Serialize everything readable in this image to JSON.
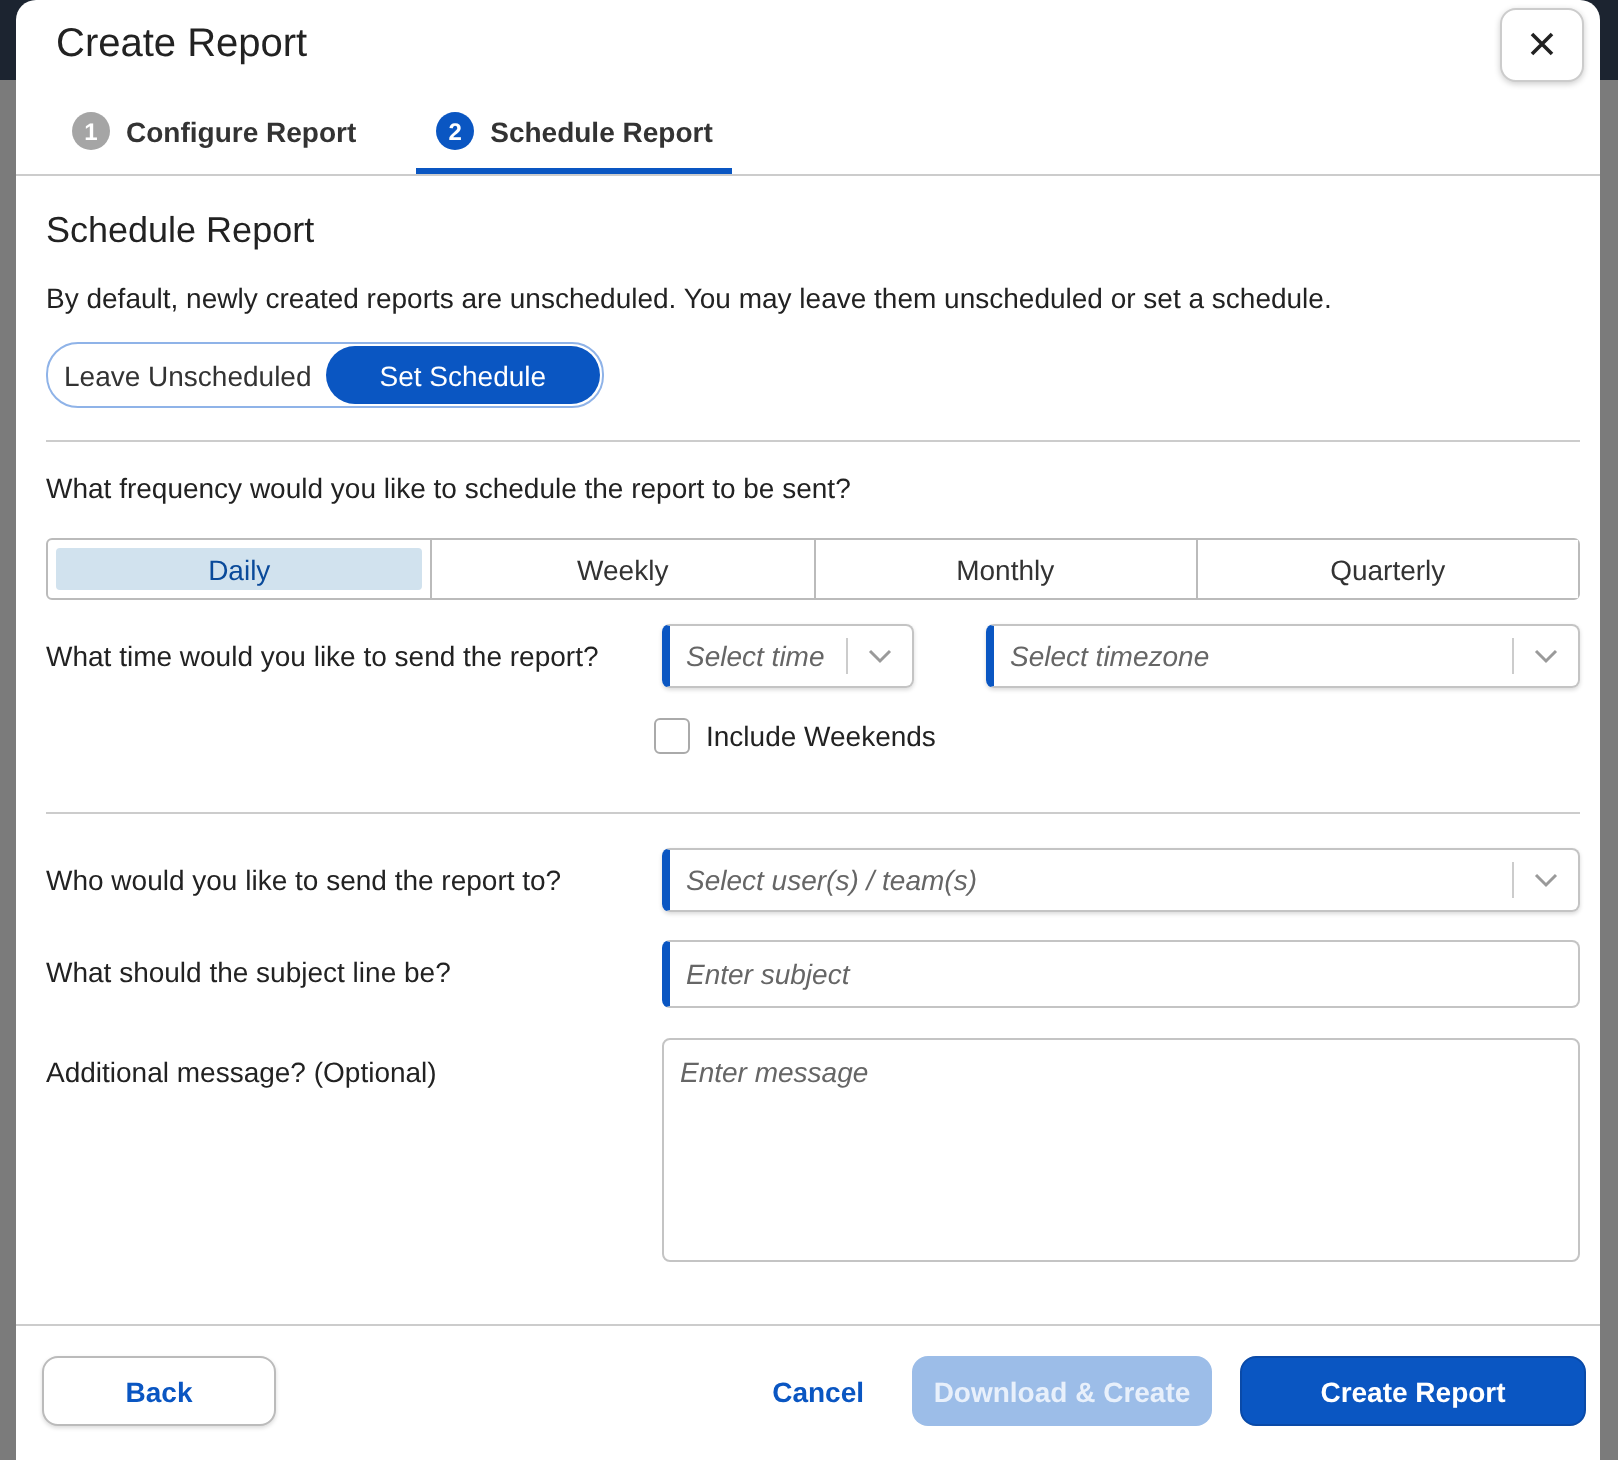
{
  "dialog": {
    "title": "Create Report"
  },
  "steps": [
    {
      "number": "1",
      "label": "Configure Report",
      "selected": false
    },
    {
      "number": "2",
      "label": "Schedule Report",
      "selected": true
    }
  ],
  "section": {
    "title": "Schedule Report",
    "description": "By default, newly created reports are unscheduled. You may leave them unscheduled or set a schedule."
  },
  "schedule_mode": [
    {
      "label": "Leave Unscheduled",
      "selected": false
    },
    {
      "label": "Set Schedule",
      "selected": true
    }
  ],
  "frequency": {
    "question": "What frequency would you like to schedule the report to be sent?",
    "options": [
      {
        "label": "Daily",
        "selected": true
      },
      {
        "label": "Weekly",
        "selected": false
      },
      {
        "label": "Monthly",
        "selected": false
      },
      {
        "label": "Quarterly",
        "selected": false
      }
    ]
  },
  "time": {
    "question": "What time would you like to send the report?",
    "time_select": {
      "placeholder": "Select time"
    },
    "timezone_select": {
      "placeholder": "Select timezone"
    },
    "include_weekends": {
      "label": "Include Weekends",
      "checked": false
    }
  },
  "recipients": {
    "question": "Who would you like to send the report to?",
    "placeholder": "Select user(s) / team(s)"
  },
  "subject": {
    "question": "What should the subject line be?",
    "placeholder": "Enter subject"
  },
  "message": {
    "question": "Additional message? (Optional)",
    "placeholder": "Enter message"
  },
  "footer": {
    "back": "Back",
    "cancel": "Cancel",
    "download_create": {
      "label": "Download & Create",
      "disabled": true
    },
    "create": "Create Report"
  }
}
